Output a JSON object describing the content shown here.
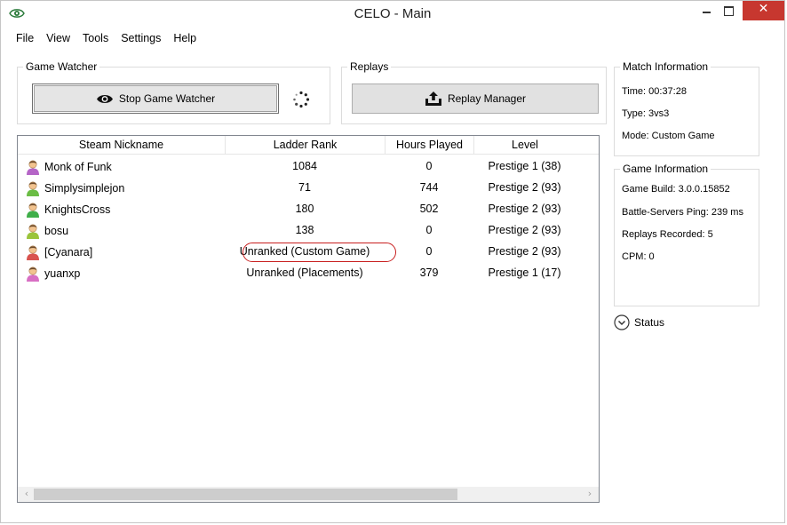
{
  "window": {
    "title": "CELO - Main",
    "close_glyph": "✕"
  },
  "menu": [
    "File",
    "View",
    "Tools",
    "Settings",
    "Help"
  ],
  "game_watcher": {
    "label": "Game Watcher",
    "button": "Stop Game Watcher"
  },
  "replays": {
    "label": "Replays",
    "button": "Replay Manager"
  },
  "match_information": {
    "label": "Match Information",
    "lines": [
      "Time: 00:37:28",
      "Type: 3vs3",
      "Mode: Custom Game"
    ]
  },
  "game_information": {
    "label": "Game Information",
    "lines": [
      "Game Build: 3.0.0.15852",
      "Battle-Servers Ping: 239 ms",
      "Replays Recorded: 5",
      "CPM: 0"
    ]
  },
  "status": {
    "label": "Status"
  },
  "table": {
    "columns": [
      "Steam Nickname",
      "Ladder Rank",
      "Hours Played",
      "Level"
    ],
    "rows": [
      {
        "name": "Monk of Funk",
        "rank": "1084",
        "hours": "0",
        "level": "Prestige 1 (38)",
        "avatar_color": "#b565c7"
      },
      {
        "name": "Simplysimplejon",
        "rank": "71",
        "hours": "744",
        "level": "Prestige 2 (93)",
        "avatar_color": "#6bbd45"
      },
      {
        "name": "KnightsCross",
        "rank": "180",
        "hours": "502",
        "level": "Prestige 2 (93)",
        "avatar_color": "#3fae49"
      },
      {
        "name": "bosu",
        "rank": "138",
        "hours": "0",
        "level": "Prestige 2 (93)",
        "avatar_color": "#9bc43b"
      },
      {
        "name": "[Cyanara]",
        "rank": "Unranked (Custom Game)",
        "hours": "0",
        "level": "Prestige 2 (93)",
        "avatar_color": "#d9534f",
        "highlighted": true
      },
      {
        "name": "yuanxp",
        "rank": "Unranked (Placements)",
        "hours": "379",
        "level": "Prestige 1 (17)",
        "avatar_color": "#d86fc4"
      }
    ]
  },
  "colors": {
    "highlight_ring": "#c81e1e",
    "close_button": "#c7372f"
  },
  "icons": {
    "app": "eye-icon",
    "stop": "eye-icon",
    "replay": "upload-icon",
    "status": "chevron-down-circle-icon",
    "spinner": "loading-spinner-icon"
  }
}
